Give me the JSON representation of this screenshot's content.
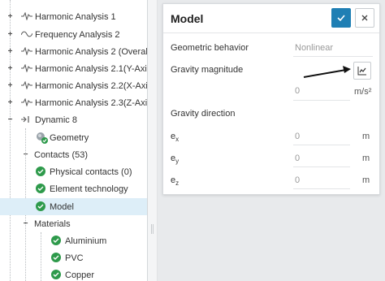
{
  "tree": {
    "items": [
      {
        "label": "Harmonic Analysis 1"
      },
      {
        "label": "Frequency Analysis 2"
      },
      {
        "label": "Harmonic Analysis 2 (Overal..."
      },
      {
        "label": "Harmonic Analysis 2.1(Y-Axi..."
      },
      {
        "label": "Harmonic Analysis 2.2(X-Axi..."
      },
      {
        "label": "Harmonic Analysis 2.3(Z-Axi..."
      },
      {
        "label": "Dynamic 8"
      },
      {
        "label": "Geometry"
      },
      {
        "label": "Contacts (53)"
      },
      {
        "label": "Physical contacts (0)"
      },
      {
        "label": "Element technology"
      },
      {
        "label": "Model"
      },
      {
        "label": "Materials"
      },
      {
        "label": "Aluminium"
      },
      {
        "label": "PVC"
      },
      {
        "label": "Copper"
      }
    ]
  },
  "panel": {
    "title": "Model",
    "geometric_behavior": {
      "label": "Geometric behavior",
      "value": "Nonlinear"
    },
    "gravity_magnitude": {
      "label": "Gravity magnitude",
      "value": "0",
      "unit": "m/s²"
    },
    "gravity_direction": {
      "label": "Gravity direction",
      "ex": {
        "label": "e",
        "sub": "x",
        "value": "0",
        "unit": "m"
      },
      "ey": {
        "label": "e",
        "sub": "y",
        "value": "0",
        "unit": "m"
      },
      "ez": {
        "label": "e",
        "sub": "z",
        "value": "0",
        "unit": "m"
      }
    }
  },
  "colors": {
    "accent": "#1f7fb4",
    "success": "#2e9a4b",
    "selected_row": "#ddeef8"
  },
  "icons": {
    "confirm": "check-icon",
    "close": "close-icon",
    "chart": "line-chart-icon",
    "analysis": "harmonic-analysis-icon",
    "frequency": "frequency-analysis-icon",
    "dynamic": "dynamic-analysis-icon",
    "geometry": "geometry-icon",
    "status": "check-circle-icon"
  }
}
